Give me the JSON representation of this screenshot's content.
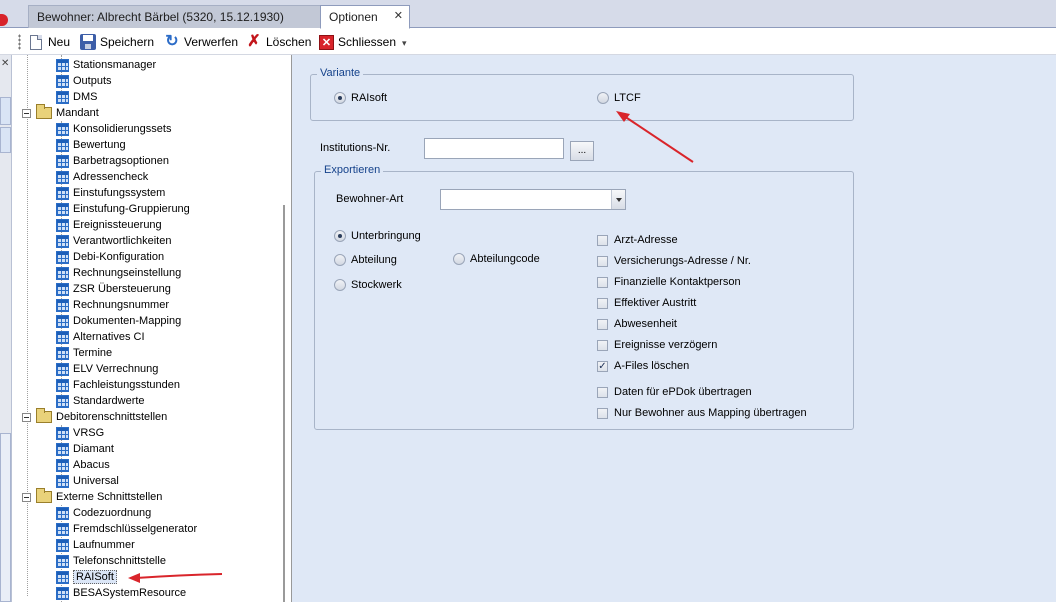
{
  "tabs": [
    {
      "label": "Bewohner: Albrecht Bärbel (5320, 15.12.1930)",
      "active": false
    },
    {
      "label": "Optionen",
      "active": true,
      "close": "✕"
    }
  ],
  "toolbar": {
    "new_label": "Neu",
    "save_label": "Speichern",
    "discard_label": "Verwerfen",
    "delete_label": "Löschen",
    "close_label": "Schliessen"
  },
  "tree": {
    "items": [
      {
        "label": "Stationsmanager",
        "type": "leaf"
      },
      {
        "label": "Outputs",
        "type": "leaf"
      },
      {
        "label": "DMS",
        "type": "leaf"
      },
      {
        "label": "Mandant",
        "type": "group"
      },
      {
        "label": "Konsolidierungssets",
        "type": "leaf"
      },
      {
        "label": "Bewertung",
        "type": "leaf"
      },
      {
        "label": "Barbetragsoptionen",
        "type": "leaf"
      },
      {
        "label": "Adressencheck",
        "type": "leaf"
      },
      {
        "label": "Einstufungssystem",
        "type": "leaf"
      },
      {
        "label": "Einstufung-Gruppierung",
        "type": "leaf"
      },
      {
        "label": "Ereignissteuerung",
        "type": "leaf"
      },
      {
        "label": "Verantwortlichkeiten",
        "type": "leaf"
      },
      {
        "label": "Debi-Konfiguration",
        "type": "leaf"
      },
      {
        "label": "Rechnungseinstellung",
        "type": "leaf"
      },
      {
        "label": "ZSR Übersteuerung",
        "type": "leaf"
      },
      {
        "label": "Rechnungsnummer",
        "type": "leaf"
      },
      {
        "label": "Dokumenten-Mapping",
        "type": "leaf"
      },
      {
        "label": "Alternatives CI",
        "type": "leaf"
      },
      {
        "label": "Termine",
        "type": "leaf"
      },
      {
        "label": "ELV Verrechnung",
        "type": "leaf"
      },
      {
        "label": "Fachleistungsstunden",
        "type": "leaf"
      },
      {
        "label": "Standardwerte",
        "type": "leaf"
      },
      {
        "label": "Debitorenschnittstellen",
        "type": "group"
      },
      {
        "label": "VRSG",
        "type": "leaf"
      },
      {
        "label": "Diamant",
        "type": "leaf"
      },
      {
        "label": "Abacus",
        "type": "leaf"
      },
      {
        "label": "Universal",
        "type": "leaf"
      },
      {
        "label": "Externe Schnittstellen",
        "type": "group"
      },
      {
        "label": "Codezuordnung",
        "type": "leaf"
      },
      {
        "label": "Fremdschlüsselgenerator",
        "type": "leaf"
      },
      {
        "label": "Laufnummer",
        "type": "leaf"
      },
      {
        "label": "Telefonschnittstelle",
        "type": "leaf"
      },
      {
        "label": "RAISoft",
        "type": "leaf",
        "selected": true
      },
      {
        "label": "BESASystemResource",
        "type": "leaf"
      }
    ]
  },
  "variante": {
    "title": "Variante",
    "options": [
      {
        "label": "RAIsoft",
        "checked": true
      },
      {
        "label": "LTCF",
        "checked": false
      }
    ]
  },
  "institution": {
    "label": "Institutions-Nr.",
    "value": "",
    "browse_label": "..."
  },
  "exportieren": {
    "title": "Exportieren",
    "bewohner_art_label": "Bewohner-Art",
    "bewohner_art_value": "",
    "radios": [
      {
        "label": "Unterbringung",
        "checked": true
      },
      {
        "label": "Abteilung",
        "checked": false
      },
      {
        "label": "Abteilungcode",
        "checked": false
      },
      {
        "label": "Stockwerk",
        "checked": false
      }
    ],
    "checkboxes": [
      {
        "label": "Arzt-Adresse",
        "checked": false
      },
      {
        "label": "Versicherungs-Adresse / Nr.",
        "checked": false
      },
      {
        "label": "Finanzielle Kontaktperson",
        "checked": false
      },
      {
        "label": "Effektiver Austritt",
        "checked": false
      },
      {
        "label": "Abwesenheit",
        "checked": false
      },
      {
        "label": "Ereignisse verzögern",
        "checked": false
      },
      {
        "label": "A-Files löschen",
        "checked": true
      },
      {
        "label": "Daten für ePDok übertragen",
        "checked": false
      },
      {
        "label": "Nur Bewohner aus Mapping übertragen",
        "checked": false
      }
    ]
  },
  "colors": {
    "content_bg": "#dfe8f6",
    "group_title": "#15428b",
    "annotation_arrow": "#d9252b"
  }
}
